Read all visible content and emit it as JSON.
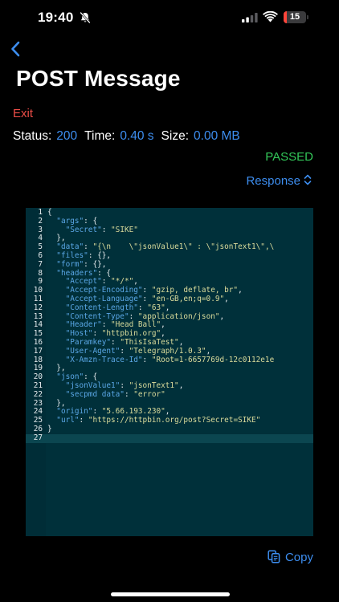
{
  "status_bar": {
    "time": "19:40",
    "battery_level": "15",
    "battery_fraction": 0.15,
    "battery_color": "#ff453a",
    "icons": [
      "bell-slash-icon",
      "cellular-signal-icon",
      "wifi-icon",
      "battery-icon"
    ]
  },
  "nav": {
    "back_icon": "chevron-left-icon",
    "title": "POST Message",
    "exit_label": "Exit"
  },
  "stats": {
    "status_label": "Status:",
    "status_value": "200",
    "time_label": "Time:",
    "time_value": "0.40 s",
    "size_label": "Size:",
    "size_value": "0.00 MB"
  },
  "result": {
    "label": "PASSED",
    "color": "#33c759"
  },
  "response_selector": {
    "label": "Response",
    "icon": "chevron-up-down-icon"
  },
  "code": {
    "active_line": 27,
    "lines": [
      [
        [
          "p",
          "{"
        ]
      ],
      [
        [
          "p",
          "  "
        ],
        [
          "k",
          "\"args\""
        ],
        [
          "p",
          ": {"
        ]
      ],
      [
        [
          "p",
          "    "
        ],
        [
          "k",
          "\"Secret\""
        ],
        [
          "p",
          ": "
        ],
        [
          "s",
          "\"SIKE\""
        ]
      ],
      [
        [
          "p",
          "  },"
        ]
      ],
      [
        [
          "p",
          "  "
        ],
        [
          "k",
          "\"data\""
        ],
        [
          "p",
          ": "
        ],
        [
          "s",
          "\"{\\n    \\\"jsonValue1\\\" : \\\"jsonText1\\\",\\"
        ]
      ],
      [
        [
          "p",
          "  "
        ],
        [
          "k",
          "\"files\""
        ],
        [
          "p",
          ": {},"
        ]
      ],
      [
        [
          "p",
          "  "
        ],
        [
          "k",
          "\"form\""
        ],
        [
          "p",
          ": {},"
        ]
      ],
      [
        [
          "p",
          "  "
        ],
        [
          "k",
          "\"headers\""
        ],
        [
          "p",
          ": {"
        ]
      ],
      [
        [
          "p",
          "    "
        ],
        [
          "k",
          "\"Accept\""
        ],
        [
          "p",
          ": "
        ],
        [
          "s",
          "\"*/*\""
        ],
        [
          "p",
          ","
        ]
      ],
      [
        [
          "p",
          "    "
        ],
        [
          "k",
          "\"Accept-Encoding\""
        ],
        [
          "p",
          ": "
        ],
        [
          "s",
          "\"gzip, deflate, br\""
        ],
        [
          "p",
          ","
        ]
      ],
      [
        [
          "p",
          "    "
        ],
        [
          "k",
          "\"Accept-Language\""
        ],
        [
          "p",
          ": "
        ],
        [
          "s",
          "\"en-GB,en;q=0.9\""
        ],
        [
          "p",
          ","
        ]
      ],
      [
        [
          "p",
          "    "
        ],
        [
          "k",
          "\"Content-Length\""
        ],
        [
          "p",
          ": "
        ],
        [
          "s",
          "\"63\""
        ],
        [
          "p",
          ","
        ]
      ],
      [
        [
          "p",
          "    "
        ],
        [
          "k",
          "\"Content-Type\""
        ],
        [
          "p",
          ": "
        ],
        [
          "s",
          "\"application/json\""
        ],
        [
          "p",
          ","
        ]
      ],
      [
        [
          "p",
          "    "
        ],
        [
          "k",
          "\"Header\""
        ],
        [
          "p",
          ": "
        ],
        [
          "s",
          "\"Head Ball\""
        ],
        [
          "p",
          ","
        ]
      ],
      [
        [
          "p",
          "    "
        ],
        [
          "k",
          "\"Host\""
        ],
        [
          "p",
          ": "
        ],
        [
          "s",
          "\"httpbin.org\""
        ],
        [
          "p",
          ","
        ]
      ],
      [
        [
          "p",
          "    "
        ],
        [
          "k",
          "\"Paramkey\""
        ],
        [
          "p",
          ": "
        ],
        [
          "s",
          "\"ThisIsaTest\""
        ],
        [
          "p",
          ","
        ]
      ],
      [
        [
          "p",
          "    "
        ],
        [
          "k",
          "\"User-Agent\""
        ],
        [
          "p",
          ": "
        ],
        [
          "s",
          "\"Telegraph/1.0.3\""
        ],
        [
          "p",
          ","
        ]
      ],
      [
        [
          "p",
          "    "
        ],
        [
          "k",
          "\"X-Amzn-Trace-Id\""
        ],
        [
          "p",
          ": "
        ],
        [
          "s",
          "\"Root=1-6657769d-12c0112e1e"
        ]
      ],
      [
        [
          "p",
          "  },"
        ]
      ],
      [
        [
          "p",
          "  "
        ],
        [
          "k",
          "\"json\""
        ],
        [
          "p",
          ": {"
        ]
      ],
      [
        [
          "p",
          "    "
        ],
        [
          "k",
          "\"jsonValue1\""
        ],
        [
          "p",
          ": "
        ],
        [
          "s",
          "\"jsonText1\""
        ],
        [
          "p",
          ","
        ]
      ],
      [
        [
          "p",
          "    "
        ],
        [
          "k",
          "\"secpmd data\""
        ],
        [
          "p",
          ": "
        ],
        [
          "s",
          "\"error\""
        ]
      ],
      [
        [
          "p",
          "  },"
        ]
      ],
      [
        [
          "p",
          "  "
        ],
        [
          "k",
          "\"origin\""
        ],
        [
          "p",
          ": "
        ],
        [
          "s",
          "\"5.66.193.230\""
        ],
        [
          "p",
          ","
        ]
      ],
      [
        [
          "p",
          "  "
        ],
        [
          "k",
          "\"url\""
        ],
        [
          "p",
          ": "
        ],
        [
          "s",
          "\"https://httpbin.org/post?Secret=SIKE\""
        ]
      ],
      [
        [
          "p",
          "}"
        ]
      ],
      [
        [
          "p",
          ""
        ]
      ]
    ]
  },
  "copy": {
    "label": "Copy",
    "icon": "copy-icon"
  },
  "colors": {
    "accent": "#3d8ef0",
    "exit": "#eb4d47",
    "code_background": "#00303a",
    "code_key": "#5aa7e6",
    "code_string": "#d9db9b"
  }
}
